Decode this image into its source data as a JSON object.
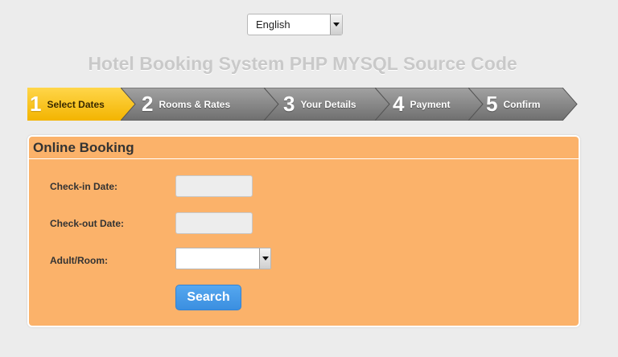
{
  "language_selector": {
    "selected": "English"
  },
  "page": {
    "title": "Hotel Booking System PHP MYSQL Source Code"
  },
  "steps": [
    {
      "number": "1",
      "label": "Select Dates",
      "active": true
    },
    {
      "number": "2",
      "label": "Rooms & Rates",
      "active": false
    },
    {
      "number": "3",
      "label": "Your Details",
      "active": false
    },
    {
      "number": "4",
      "label": "Payment",
      "active": false
    },
    {
      "number": "5",
      "label": "Confirm",
      "active": false
    }
  ],
  "booking": {
    "title": "Online Booking",
    "checkin_label": "Check-in Date:",
    "checkin_value": "",
    "checkout_label": "Check-out Date:",
    "checkout_value": "",
    "adult_label": "Adult/Room:",
    "adult_value": "",
    "search_label": "Search"
  },
  "colors": {
    "step_active": "#fcc318",
    "step_inactive": "#8a8a8a",
    "panel_bg": "#fbb26a",
    "search_button": "#4a9be8",
    "title_text": "#c9c9c9"
  }
}
